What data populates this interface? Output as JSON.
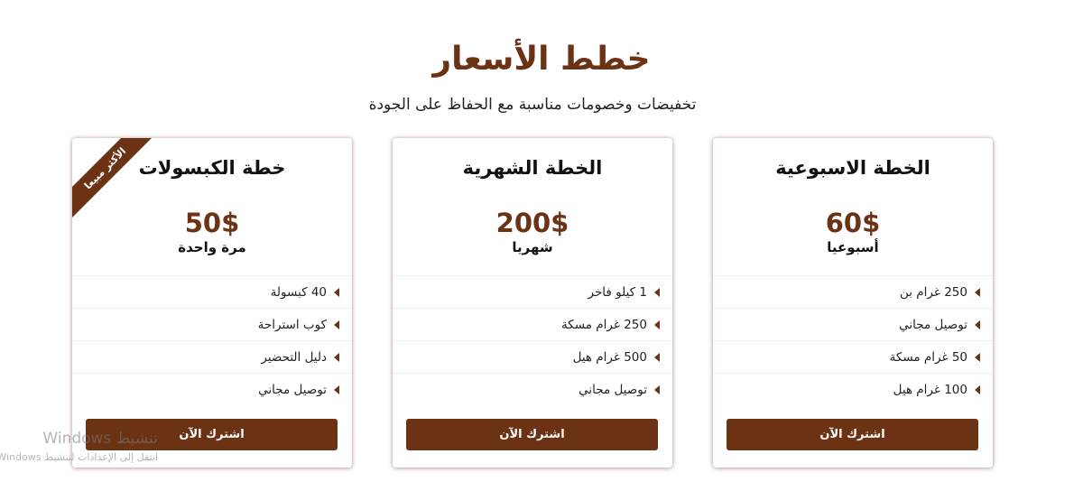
{
  "section": {
    "title": "خطط الأسعار",
    "subtitle": "تخفيضات وخصومات مناسبة مع الحفاظ على الجودة"
  },
  "plans": [
    {
      "title": "الخطة الاسبوعية",
      "price": "60$",
      "period": "أسبوعيا",
      "features": [
        "250 غرام بن",
        "توصيل مجاني",
        "50 غرام مسكة",
        "100 غرام هيل"
      ],
      "button_label": "اشترك الآن"
    },
    {
      "title": "الخطة الشهرية",
      "price": "200$",
      "period": "شهريا",
      "features": [
        "1 كيلو فاخر",
        "250 غرام مسكة",
        "500 غرام هيل",
        "توصيل مجاني"
      ],
      "button_label": "اشترك الآن"
    },
    {
      "title": "خطة الكبسولات",
      "price": "50$",
      "period": "مرة واحدة",
      "features": [
        "40 كبسولة",
        "كوب استراحة",
        "دليل التحضير",
        "توصيل مجاني"
      ],
      "button_label": "اشترك الآن",
      "ribbon": "الأكثر مبيعا"
    }
  ],
  "watermark": {
    "line1": "تنشيط Windows",
    "line2": "انتقل إلى الإعدادات لتنشيط Windows"
  },
  "colors": {
    "accent": "#6b3214"
  },
  "icons": {
    "feature_bullet": "caret-left-icon"
  }
}
